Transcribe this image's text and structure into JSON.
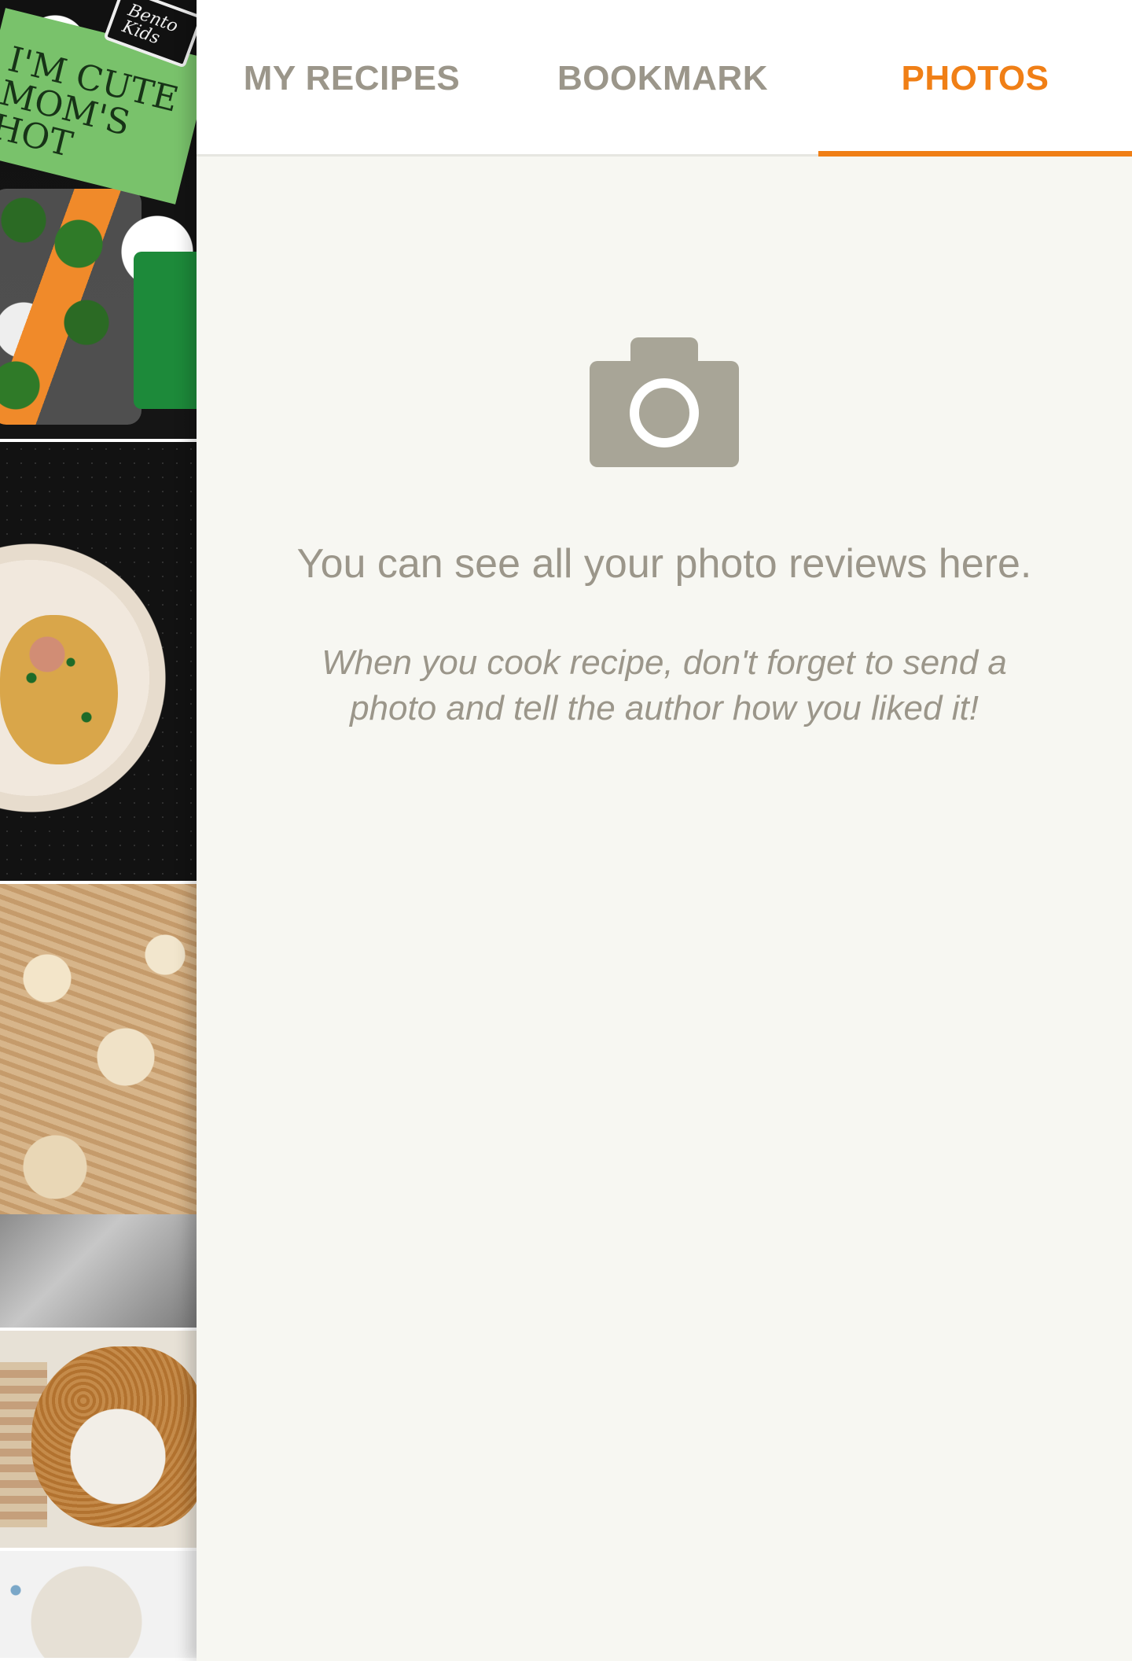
{
  "colors": {
    "accent": "#f07f16",
    "muted_text": "#9b968a",
    "background": "#f7f7f2"
  },
  "background_photos": {
    "photo1": {
      "card_text": "I'M CUTE MOM'S HOT",
      "tag_text": "Bento Kids"
    }
  },
  "tabs": [
    {
      "label": "MY RECIPES",
      "selected": false
    },
    {
      "label": "BOOKMARK",
      "selected": false
    },
    {
      "label": "PHOTOS",
      "selected": true
    }
  ],
  "empty_state": {
    "icon": "camera-icon",
    "title": "You can see all your photo reviews here.",
    "subtitle": "When you cook recipe, don't forget to send a photo and tell the author how you liked it!"
  }
}
